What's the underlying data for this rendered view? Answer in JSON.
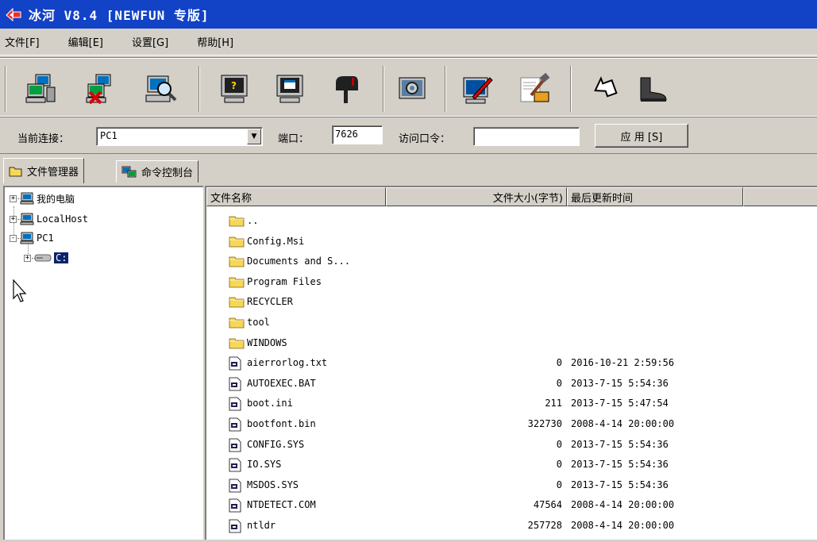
{
  "window": {
    "title": "冰河 V8.4 [NEWFUN 专版]"
  },
  "menu": {
    "items": [
      "文件[F]",
      "编辑[E]",
      "设置[G]",
      "帮助[H]"
    ]
  },
  "toolbar": {
    "buttons": [
      {
        "name": "add-host-button",
        "icon": "computer-network-icon"
      },
      {
        "name": "remove-host-button",
        "icon": "computer-delete-icon"
      },
      {
        "name": "search-host-button",
        "icon": "computer-search-icon"
      },
      {
        "name": "screen-info-button",
        "icon": "monitor-question-icon"
      },
      {
        "name": "screen-capture-button",
        "icon": "monitor-window-icon"
      },
      {
        "name": "mail-button",
        "icon": "mailbox-icon"
      },
      {
        "name": "settings-button",
        "icon": "gear-screen-icon"
      },
      {
        "name": "edit-config-button",
        "icon": "monitor-pen-icon"
      },
      {
        "name": "tools-button",
        "icon": "hammer-icon"
      },
      {
        "name": "back-button",
        "icon": "arrow-up-left-icon"
      },
      {
        "name": "exit-button",
        "icon": "boot-icon"
      }
    ]
  },
  "connection": {
    "current_label": "当前连接：",
    "current_value": "PC1",
    "port_label": "端口：",
    "port_value": "7626",
    "password_label": "访问口令：",
    "password_value": "",
    "apply_label": "应 用 [S]"
  },
  "tabs": [
    {
      "label": "文件管理器",
      "active": true
    },
    {
      "label": "命令控制台",
      "active": false
    }
  ],
  "tree": {
    "nodes": [
      {
        "label": "我的电脑",
        "expander": "+"
      },
      {
        "label": "LocalHost",
        "expander": "+"
      },
      {
        "label": "PC1",
        "expander": "-"
      },
      {
        "label": "C:",
        "expander": "+",
        "selected": true
      }
    ]
  },
  "file_list": {
    "columns": [
      "文件名称",
      "文件大小(字节)",
      "最后更新时间"
    ],
    "rows": [
      {
        "name": "..",
        "type": "folder",
        "size": "",
        "date": ""
      },
      {
        "name": "Config.Msi",
        "type": "folder",
        "size": "",
        "date": ""
      },
      {
        "name": "Documents and S...",
        "type": "folder",
        "size": "",
        "date": ""
      },
      {
        "name": "Program Files",
        "type": "folder",
        "size": "",
        "date": ""
      },
      {
        "name": "RECYCLER",
        "type": "folder",
        "size": "",
        "date": ""
      },
      {
        "name": "tool",
        "type": "folder",
        "size": "",
        "date": ""
      },
      {
        "name": "WINDOWS",
        "type": "folder",
        "size": "",
        "date": ""
      },
      {
        "name": "aierrorlog.txt",
        "type": "file",
        "size": "0",
        "date": "2016-10-21 2:59:56"
      },
      {
        "name": "AUTOEXEC.BAT",
        "type": "file",
        "size": "0",
        "date": "2013-7-15 5:54:36"
      },
      {
        "name": "boot.ini",
        "type": "file",
        "size": "211",
        "date": "2013-7-15 5:47:54"
      },
      {
        "name": "bootfont.bin",
        "type": "file",
        "size": "322730",
        "date": "2008-4-14 20:00:00"
      },
      {
        "name": "CONFIG.SYS",
        "type": "file",
        "size": "0",
        "date": "2013-7-15 5:54:36"
      },
      {
        "name": "IO.SYS",
        "type": "file",
        "size": "0",
        "date": "2013-7-15 5:54:36"
      },
      {
        "name": "MSDOS.SYS",
        "type": "file",
        "size": "0",
        "date": "2013-7-15 5:54:36"
      },
      {
        "name": "NTDETECT.COM",
        "type": "file",
        "size": "47564",
        "date": "2008-4-14 20:00:00"
      },
      {
        "name": "ntldr",
        "type": "file",
        "size": "257728",
        "date": "2008-4-14 20:00:00"
      }
    ]
  },
  "colors": {
    "titlebar": "#1242c6",
    "face": "#d4d0c8",
    "selection": "#0a246a",
    "folder": "#f7d65a"
  }
}
